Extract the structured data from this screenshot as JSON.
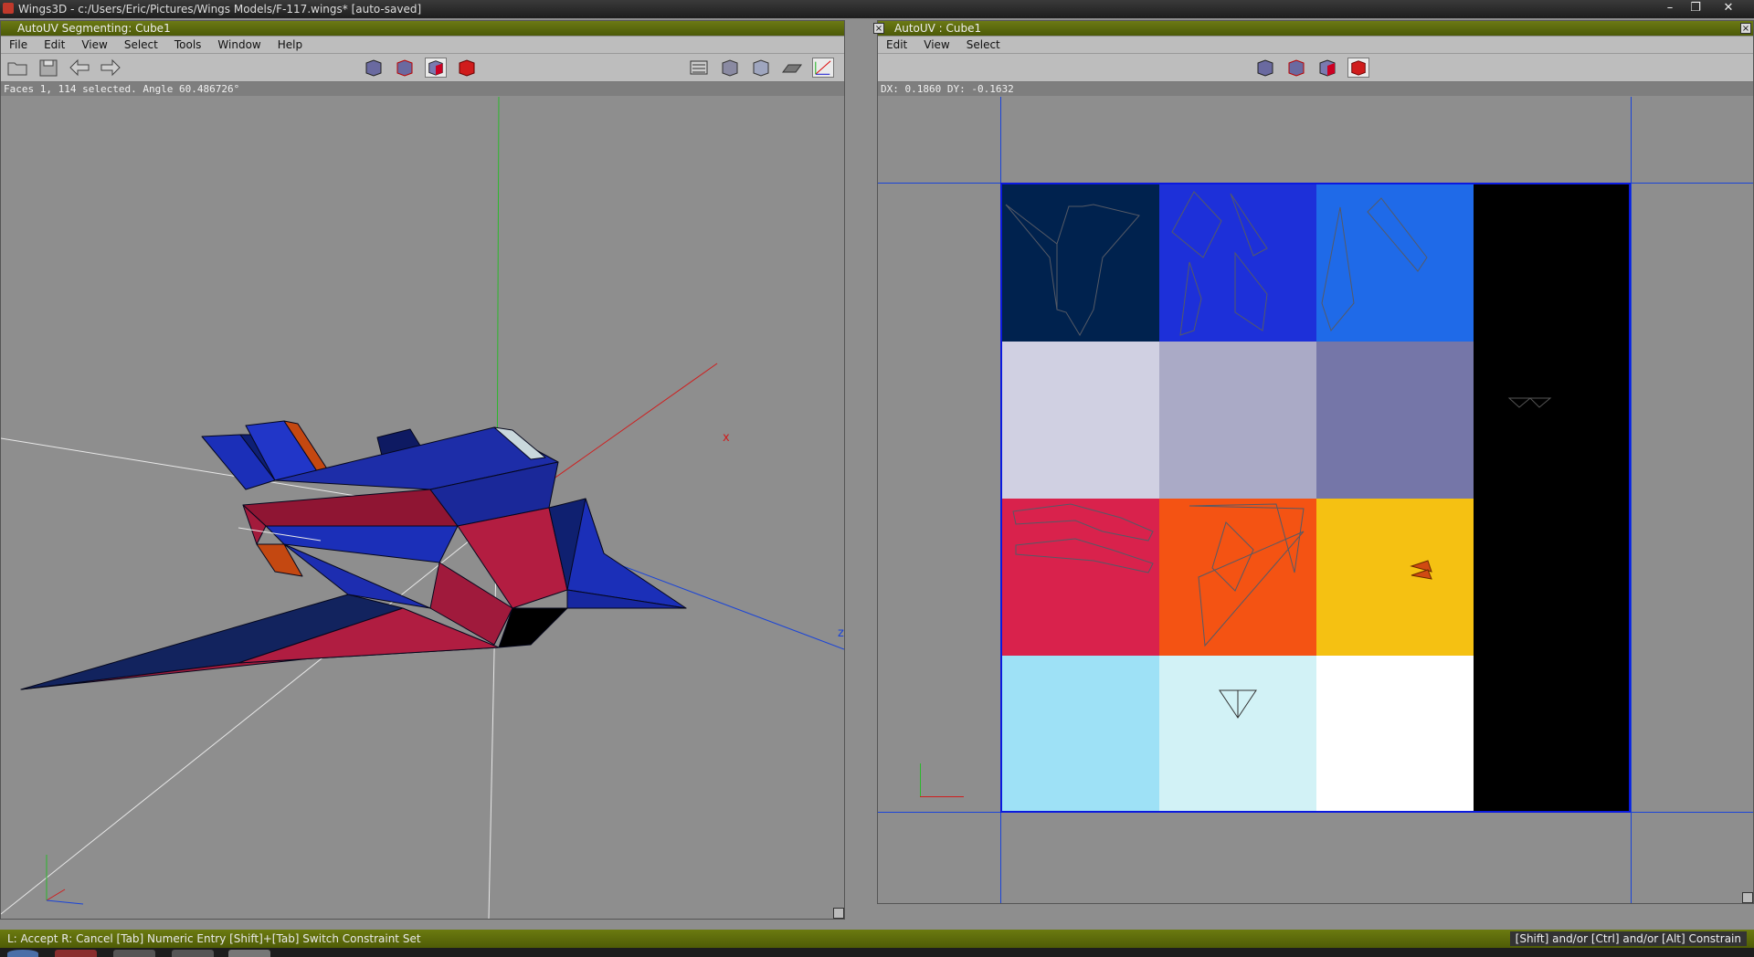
{
  "os_window": {
    "title": "Wings3D - c:/Users/Eric/Pictures/Wings Models/F-117.wings* [auto-saved]",
    "controls": [
      "–",
      "❐",
      "✕"
    ]
  },
  "left_window": {
    "title": "AutoUV Segmenting: Cube1",
    "menu": [
      "File",
      "Edit",
      "View",
      "Select",
      "Tools",
      "Window",
      "Help"
    ],
    "status": "Faces 1, 114 selected. Angle 60.486726°",
    "axis_labels": {
      "x": "x",
      "z": "z"
    }
  },
  "right_window": {
    "title": "AutoUV : Cube1",
    "menu": [
      "Edit",
      "View",
      "Select"
    ],
    "status": "DX: 0.1860  DY: -0.1632",
    "uv_colors": [
      [
        "#00224e",
        "#1d30d9",
        "#1f6ae8"
      ],
      [
        "#d0d0e2",
        "#aaaac6",
        "#7576a8"
      ],
      [
        "#d9224c",
        "#f45313",
        "#f5c112"
      ],
      [
        "#9ee1f6",
        "#d2f2f6",
        "#ffffff"
      ]
    ],
    "uv_side_color": "#000000"
  },
  "info_bar": {
    "left": "L: Accept   R: Cancel   [Tab] Numeric Entry   [Shift]+[Tab] Switch Constraint Set",
    "right": "[Shift] and/or [Ctrl] and/or [Alt] Constrain"
  },
  "colors": {
    "title_bar": "#5a6a0c",
    "accent_blue": "#1b2fb8",
    "accent_red": "#a31b3c"
  }
}
